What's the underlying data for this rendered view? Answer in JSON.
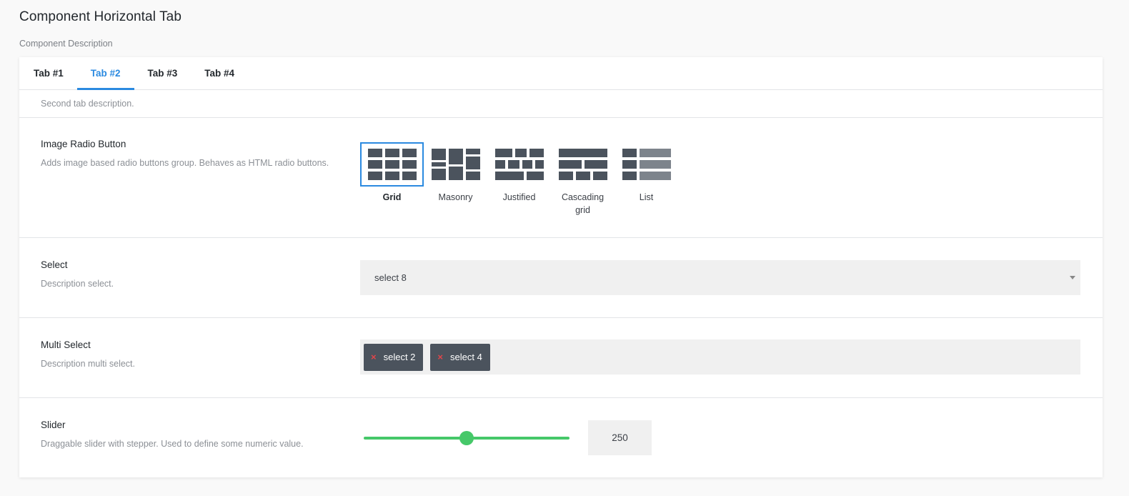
{
  "page": {
    "title": "Component Horizontal Tab",
    "description": "Component Description"
  },
  "tabs": [
    {
      "label": "Tab #1",
      "active": false
    },
    {
      "label": "Tab #2",
      "active": true
    },
    {
      "label": "Tab #3",
      "active": false
    },
    {
      "label": "Tab #4",
      "active": false
    }
  ],
  "tab_description": "Second tab description.",
  "image_radio": {
    "label": "Image Radio Button",
    "description": "Adds image based radio buttons group. Behaves as HTML radio buttons.",
    "options": [
      {
        "label": "Grid",
        "icon": "grid-layout-icon",
        "selected": true
      },
      {
        "label": "Masonry",
        "icon": "masonry-layout-icon",
        "selected": false
      },
      {
        "label": "Justified",
        "icon": "justified-layout-icon",
        "selected": false
      },
      {
        "label": "Cascading grid",
        "icon": "cascading-grid-layout-icon",
        "selected": false
      },
      {
        "label": "List",
        "icon": "list-layout-icon",
        "selected": false
      }
    ]
  },
  "select": {
    "label": "Select",
    "description": "Description select.",
    "value": "select 8"
  },
  "multi_select": {
    "label": "Multi Select",
    "description": "Description multi select.",
    "chips": [
      "select 2",
      "select 4"
    ],
    "remove_glyph": "×"
  },
  "slider": {
    "label": "Slider",
    "description": "Draggable slider with stepper. Used to define some numeric value.",
    "value": "250",
    "fraction": 0.5
  },
  "colors": {
    "accent": "#2b8ae0",
    "slider": "#46c869",
    "chip_bg": "#4b535d",
    "chip_remove": "#e2454a",
    "icon": "#4b535d"
  }
}
